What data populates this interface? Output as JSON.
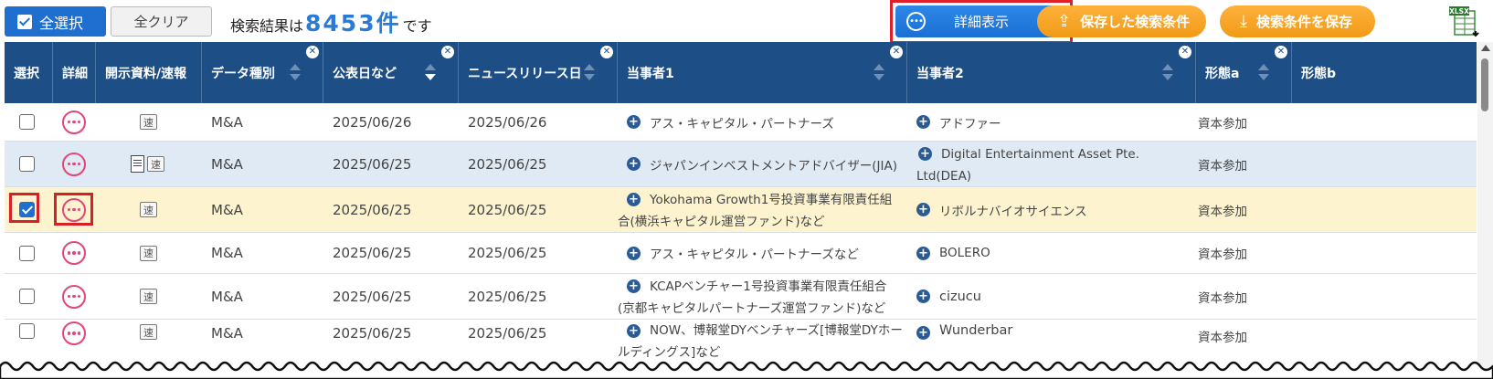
{
  "toolbar": {
    "select_all": "全選択",
    "clear_all": "全クリア",
    "result_prefix": "検索結果は",
    "result_count": "8453件",
    "result_suffix": "です",
    "detail_button": "詳細表示",
    "saved_conditions": "保存した検索条件",
    "save_conditions": "検索条件を保存",
    "xlsx_label": "XLSX"
  },
  "columns": [
    "選択",
    "詳細",
    "開示資料/速報",
    "データ種別",
    "公表日など",
    "ニュースリリース日",
    "当事者1",
    "当事者2",
    "形態a",
    "形態b"
  ],
  "soku_label": "速",
  "rows": [
    {
      "type": "M&A",
      "pub": "2025/06/26",
      "news": "2025/06/26",
      "p1": "アス・キャピタル・パートナーズ",
      "p2": "アドファー",
      "forma": "資本参加",
      "checked": false,
      "doc": false
    },
    {
      "type": "M&A",
      "pub": "2025/06/25",
      "news": "2025/06/25",
      "p1": "ジャパンインベストメントアドバイザー(JIA)",
      "p2": "Digital Entertainment Asset Pte. Ltd(DEA)",
      "forma": "資本参加",
      "checked": false,
      "doc": true
    },
    {
      "type": "M&A",
      "pub": "2025/06/25",
      "news": "2025/06/25",
      "p1": "Yokohama Growth1号投資事業有限責任組合(横浜キャピタル運営ファンド)など",
      "p2": "リボルナバイオサイエンス",
      "forma": "資本参加",
      "checked": true,
      "doc": false
    },
    {
      "type": "M&A",
      "pub": "2025/06/25",
      "news": "2025/06/25",
      "p1": "アス・キャピタル・パートナーズなど",
      "p2": "BOLERO",
      "forma": "資本参加",
      "checked": false,
      "doc": false
    },
    {
      "type": "M&A",
      "pub": "2025/06/25",
      "news": "2025/06/25",
      "p1": "KCAPベンチャー1号投資事業有限責任組合(京都キャピタルパートナーズ運営ファンド)など",
      "p2": "cizucu",
      "forma": "資本参加",
      "checked": false,
      "doc": false
    },
    {
      "type": "M&A",
      "pub": "2025/06/25",
      "news": "2025/06/25",
      "p1": "NOW、博報堂DYベンチャーズ[博報堂DYホールディングス]など",
      "p2": "Wunderbar",
      "forma": "資本参加",
      "checked": false,
      "doc": false
    }
  ],
  "colors": {
    "header_bg": "#1d4f86",
    "accent_blue": "#1f6fd1",
    "orange": "#f29a16",
    "selected_row": "#fdf3cf",
    "alt_row": "#dfeaf5",
    "highlight_red": "#e01f2a"
  }
}
